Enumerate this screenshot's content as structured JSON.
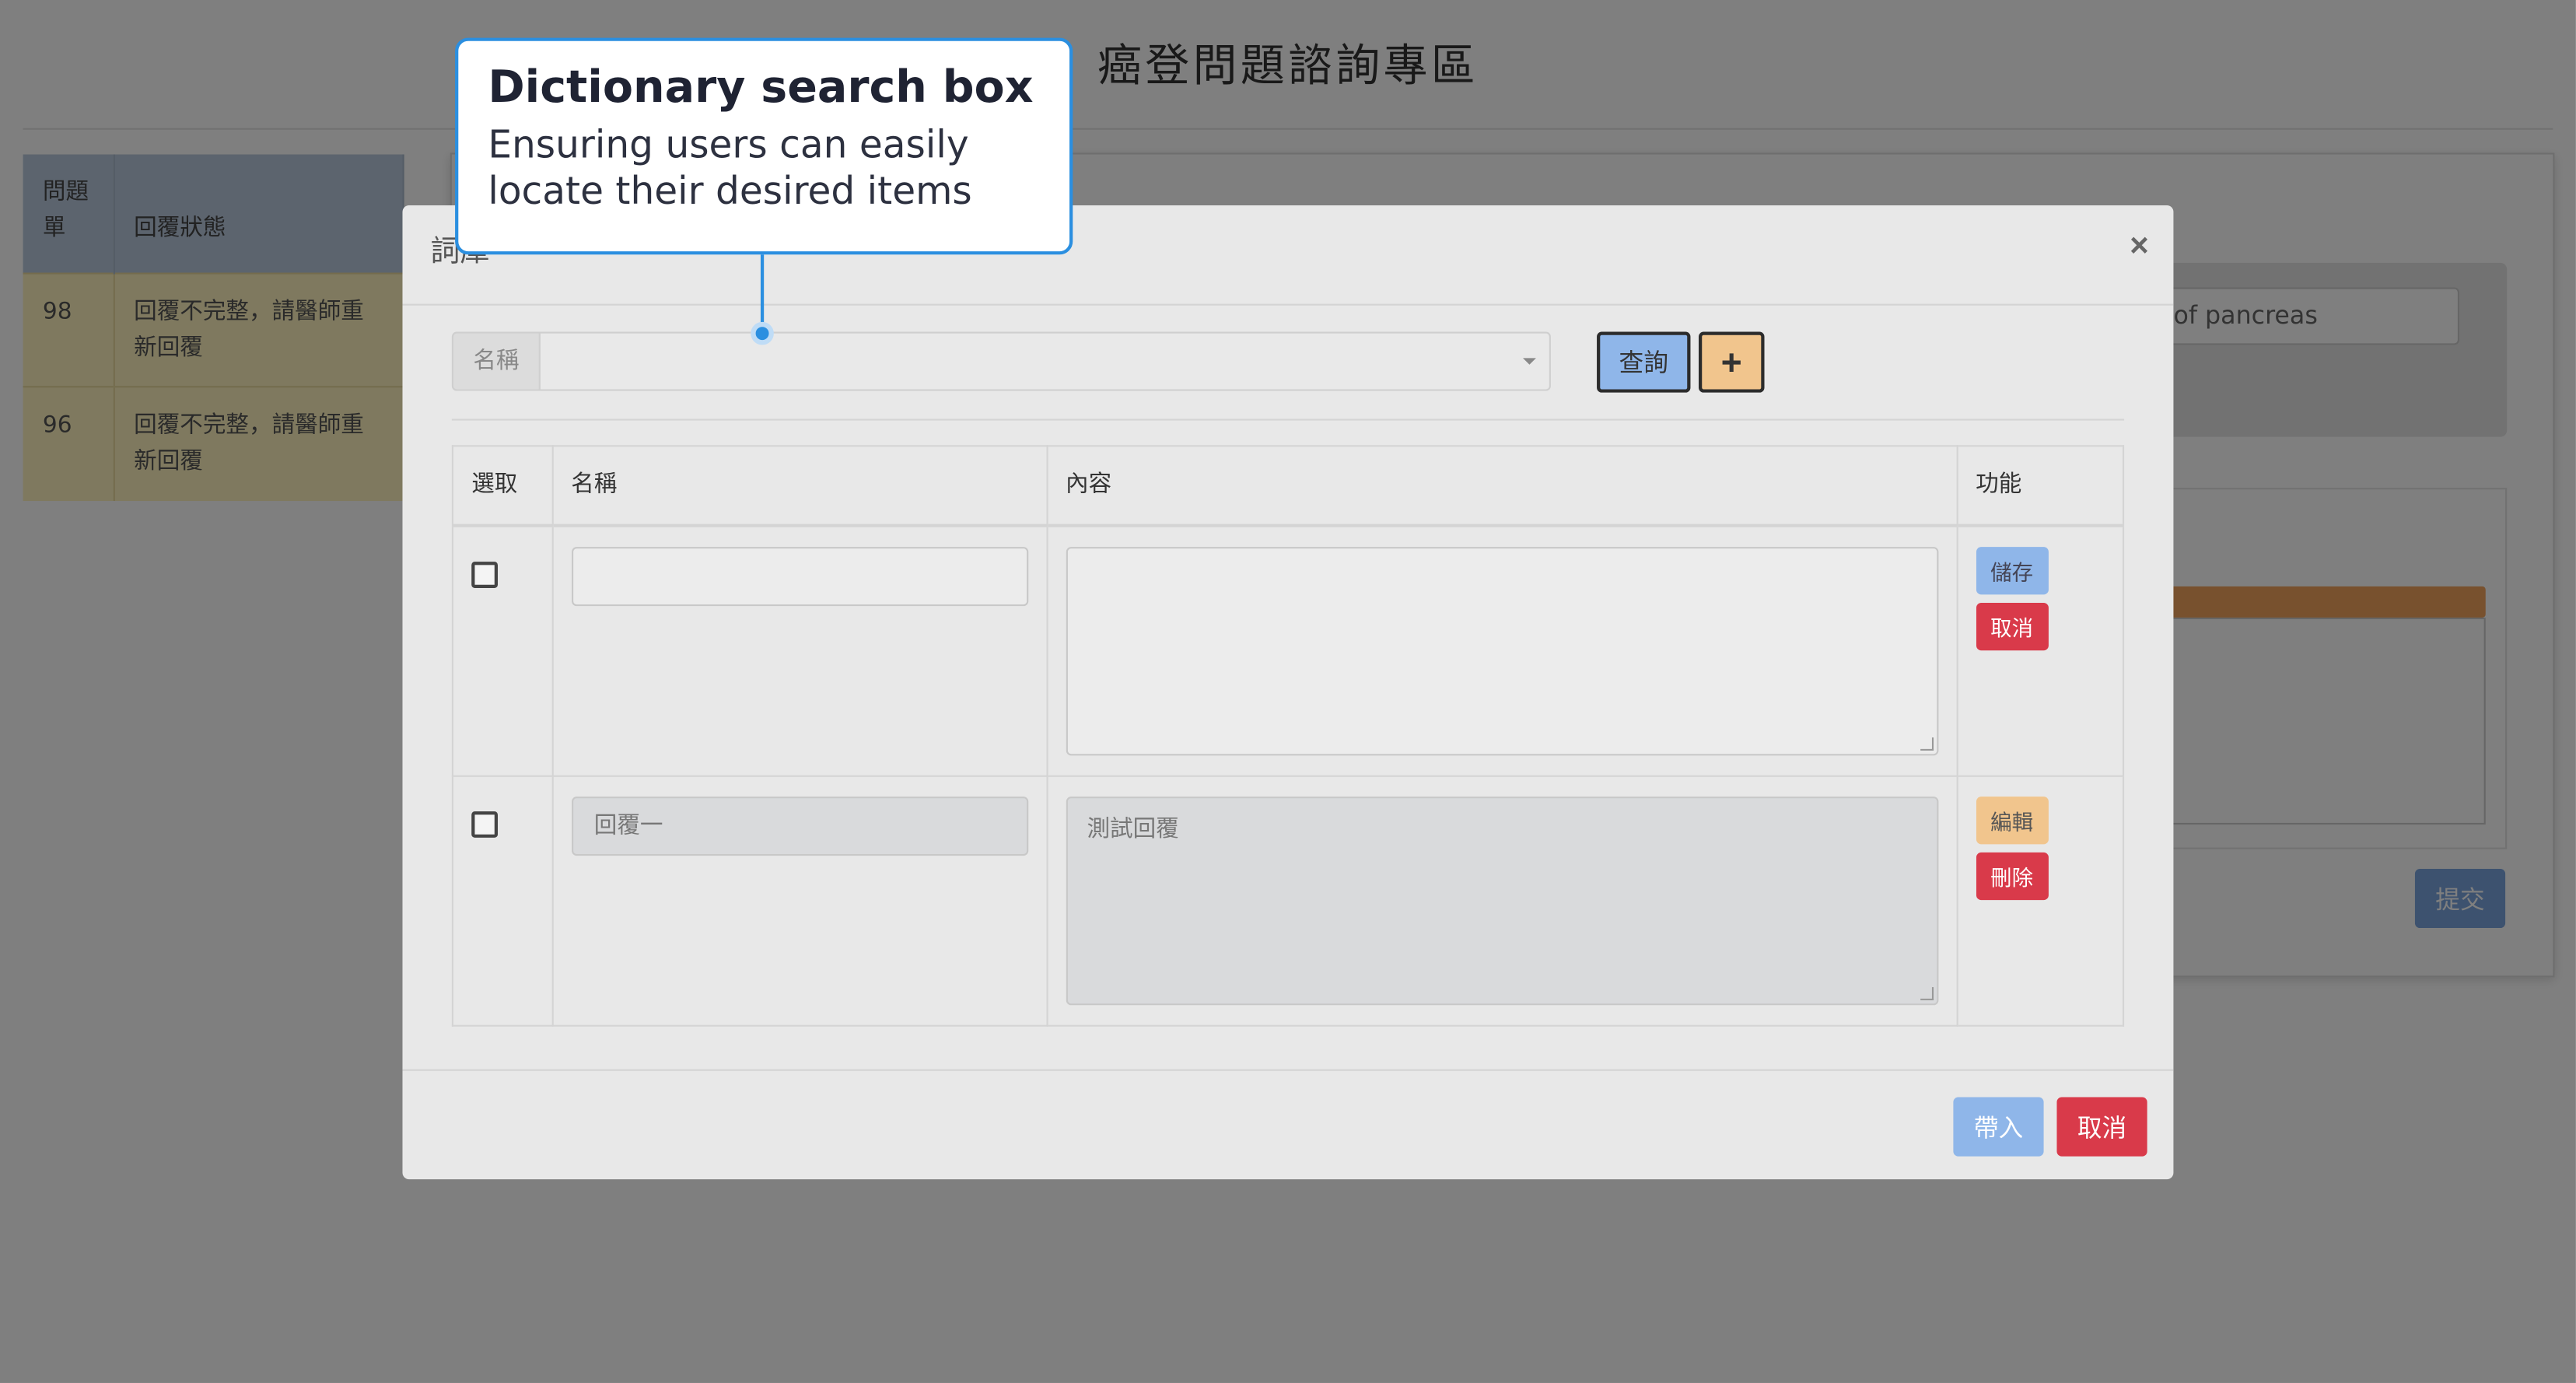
{
  "page": {
    "title": "癌登問題諮詢專區"
  },
  "list": {
    "headers": [
      "問題單",
      "回覆狀態"
    ],
    "rows": [
      {
        "id": "98",
        "status": "回覆不完整，請醫師重新回覆"
      },
      {
        "id": "96",
        "status": "回覆不完整，請醫師重新回覆"
      }
    ]
  },
  "background_form": {
    "search_value": "of pancreas",
    "submit_label": "提交"
  },
  "modal": {
    "title": "詞庫",
    "close_glyph": "×",
    "search": {
      "label": "名稱",
      "query_label": "查詢",
      "add_glyph": "+"
    },
    "table": {
      "headers": [
        "選取",
        "名稱",
        "內容",
        "功能"
      ],
      "rows": [
        {
          "name": "",
          "content": "",
          "actions": [
            "儲存",
            "取消"
          ],
          "editing": true
        },
        {
          "name": "回覆一",
          "content": "測試回覆",
          "actions": [
            "編輯",
            "刪除"
          ],
          "editing": false
        }
      ]
    },
    "footer": {
      "import_label": "帶入",
      "cancel_label": "取消"
    }
  },
  "callout": {
    "title": "Dictionary search box",
    "body": "Ensuring users can easily locate their desired items",
    "accent_color": "#2b8fe0"
  }
}
